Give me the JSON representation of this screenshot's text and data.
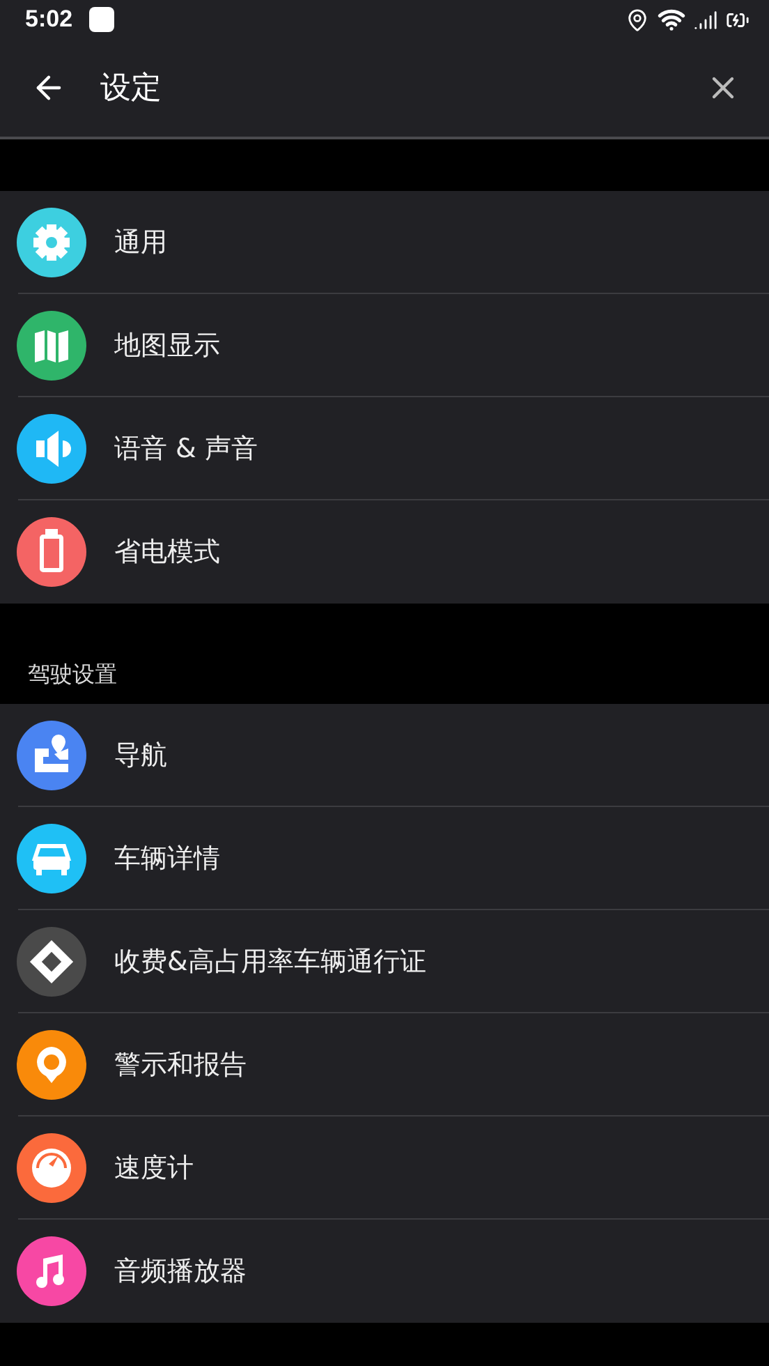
{
  "status_bar": {
    "time": "5:02"
  },
  "app_bar": {
    "title": "设定"
  },
  "sections": [
    {
      "items": [
        {
          "label": "通用",
          "kind": "gear",
          "color": "#3dcfe0"
        },
        {
          "label": "地图显示",
          "kind": "map",
          "color": "#2fb56a"
        },
        {
          "label": "语音 & 声音",
          "kind": "speaker",
          "color": "#1fb8f5"
        },
        {
          "label": "省电模式",
          "kind": "battery",
          "color": "#f46464"
        }
      ]
    },
    {
      "header": "驾驶设置",
      "items": [
        {
          "label": "导航",
          "kind": "route",
          "color": "#4a84f2"
        },
        {
          "label": "车辆详情",
          "kind": "car",
          "color": "#1fc0f5"
        },
        {
          "label": "收费&高占用率车辆通行证",
          "kind": "diamond",
          "color": "#4a4a4a"
        },
        {
          "label": "警示和报告",
          "kind": "pin",
          "color": "#f98a0a"
        },
        {
          "label": "速度计",
          "kind": "gauge",
          "color": "#fb6a3c"
        },
        {
          "label": "音频播放器",
          "kind": "music",
          "color": "#f748a4"
        }
      ]
    }
  ]
}
